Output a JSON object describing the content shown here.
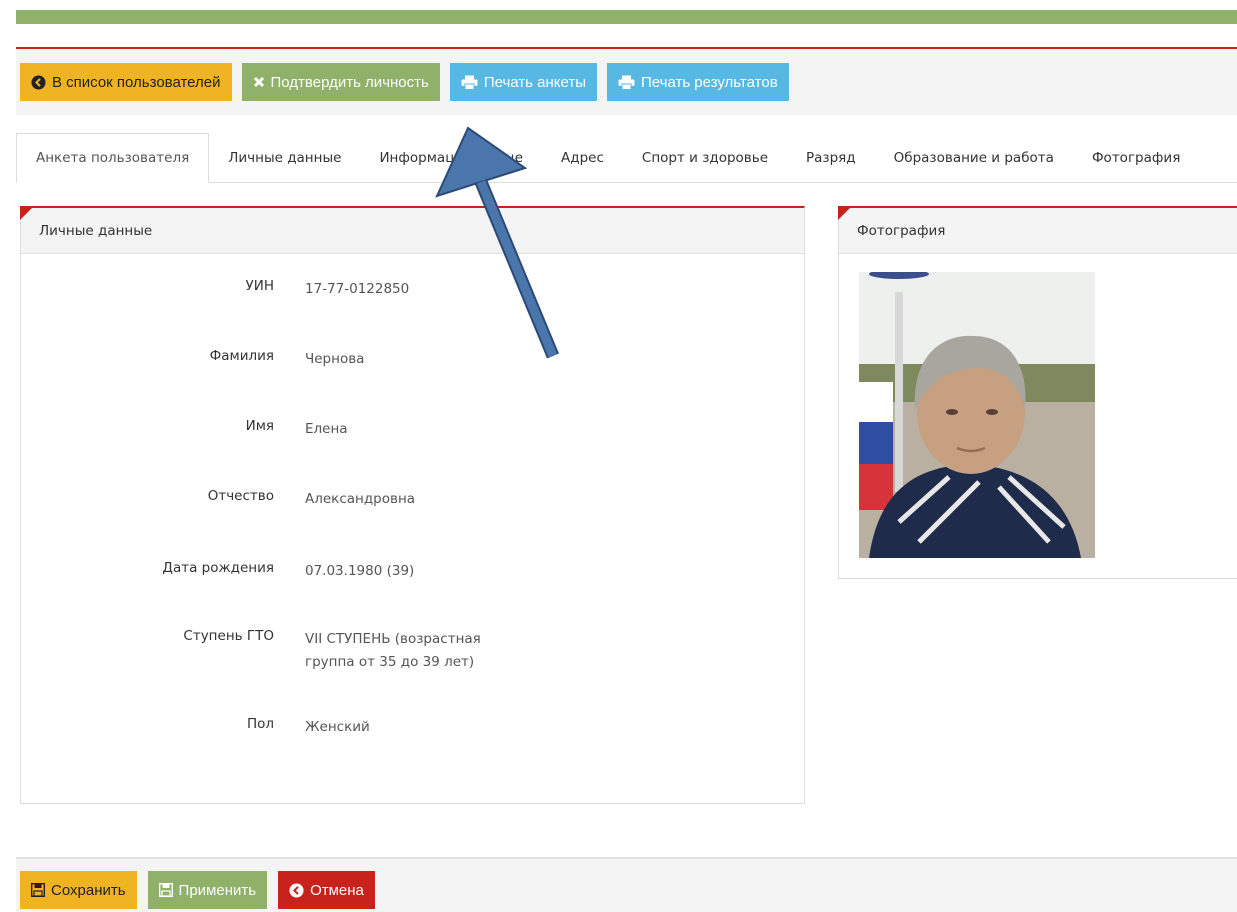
{
  "toolbar": {
    "back_label": "В список пользователей",
    "confirm_label": "Подтвердить личность",
    "print_form_label": "Печать анкеты",
    "print_results_label": "Печать результатов"
  },
  "tabs": [
    {
      "label": "Анкета пользователя",
      "active": true
    },
    {
      "label": "Личные данные"
    },
    {
      "label": "Информация о лице"
    },
    {
      "label": "Адрес"
    },
    {
      "label": "Спорт и здоровье"
    },
    {
      "label": "Разряд"
    },
    {
      "label": "Образование и работа"
    },
    {
      "label": "Фотография"
    }
  ],
  "personal": {
    "title": "Личные данные",
    "fields": [
      {
        "label": "УИН",
        "value": "17-77-0122850"
      },
      {
        "label": "Фамилия",
        "value": "Чернова"
      },
      {
        "label": "Имя",
        "value": "Елена"
      },
      {
        "label": "Отчество",
        "value": "Александровна"
      },
      {
        "label": "Дата рождения",
        "value": "07.03.1980 (39)"
      },
      {
        "label": "Ступень ГТО",
        "value": "VII СТУПЕНЬ (возрастная группа от 35 до 39 лет)"
      },
      {
        "label": "Пол",
        "value": "Женский"
      }
    ]
  },
  "photo_panel": {
    "title": "Фотография"
  },
  "bottom": {
    "save_label": "Сохранить",
    "apply_label": "Применить",
    "cancel_label": "Отмена"
  },
  "colors": {
    "accent_green": "#8fb16a",
    "accent_red": "#c8221c",
    "accent_yellow": "#f0b323",
    "accent_blue": "#56b8e3",
    "annotation_arrow": "#3f6fa6"
  },
  "icons": [
    "chevron-circle-left-icon",
    "times-icon",
    "print-icon",
    "floppy-icon"
  ]
}
